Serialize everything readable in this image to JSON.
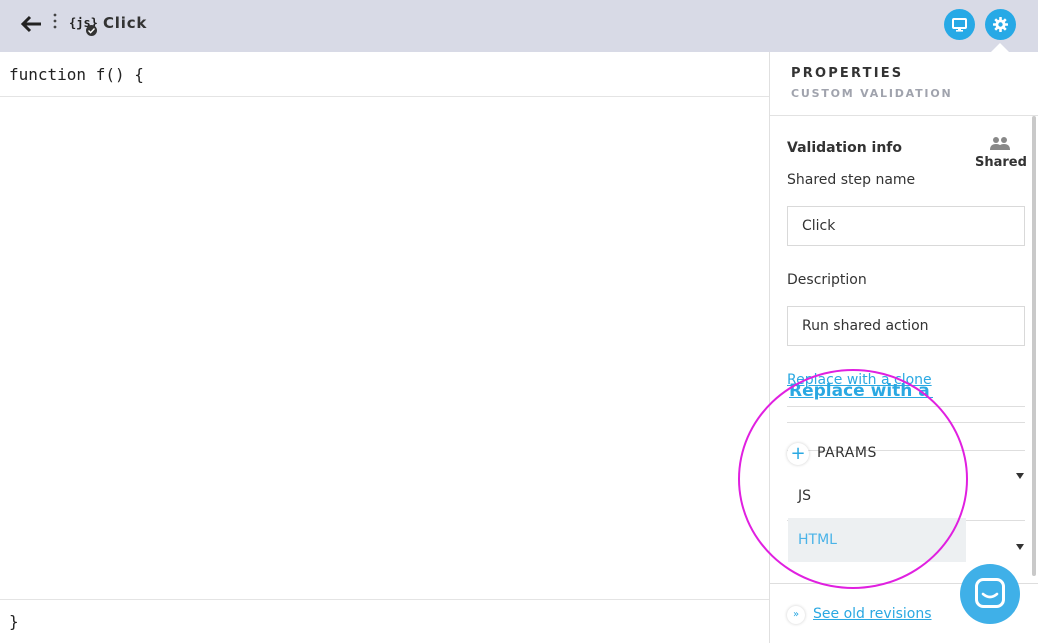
{
  "header": {
    "title": "Click",
    "js_badge": "{js}",
    "colors": {
      "bar": "#d8dae6",
      "accent": "#27a9e6"
    }
  },
  "icons": {
    "back": "back-arrow-icon",
    "menu": "kebab-menu-icon",
    "script": "js-script-icon",
    "preview": "monitor-icon",
    "settings": "gear-icon",
    "shared": "users-icon",
    "chat": "chat-icon"
  },
  "editor": {
    "first_line": "function f() {",
    "last_line": "}"
  },
  "panel": {
    "title": "PROPERTIES",
    "subtitle": "CUSTOM VALIDATION",
    "validation_info_label": "Validation info",
    "shared_label": "Shared",
    "step_name_label": "Shared step name",
    "step_name_value": "Click",
    "description_label": "Description",
    "description_value": "Run shared action",
    "link_small": "Replace with a clone",
    "link_large": "Replace with a clone",
    "params_label": "PARAMS",
    "options": [
      "JS",
      "HTML"
    ],
    "revisions_link": "See old revisions"
  }
}
